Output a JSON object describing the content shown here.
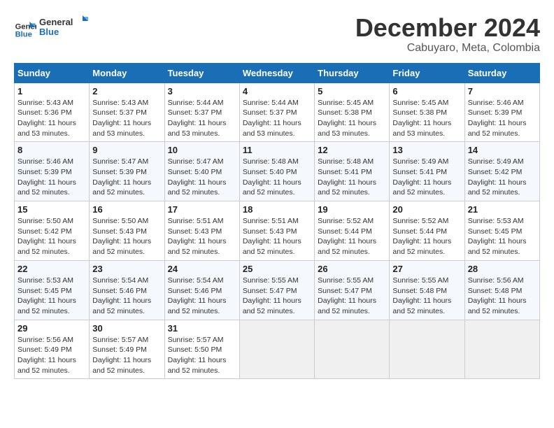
{
  "logo": {
    "line1": "General",
    "line2": "Blue"
  },
  "title": "December 2024",
  "subtitle": "Cabuyaro, Meta, Colombia",
  "days_of_week": [
    "Sunday",
    "Monday",
    "Tuesday",
    "Wednesday",
    "Thursday",
    "Friday",
    "Saturday"
  ],
  "weeks": [
    [
      {
        "day": 1,
        "sunrise": "5:43 AM",
        "sunset": "5:36 PM",
        "daylight": "11 hours and 53 minutes."
      },
      {
        "day": 2,
        "sunrise": "5:43 AM",
        "sunset": "5:37 PM",
        "daylight": "11 hours and 53 minutes."
      },
      {
        "day": 3,
        "sunrise": "5:44 AM",
        "sunset": "5:37 PM",
        "daylight": "11 hours and 53 minutes."
      },
      {
        "day": 4,
        "sunrise": "5:44 AM",
        "sunset": "5:37 PM",
        "daylight": "11 hours and 53 minutes."
      },
      {
        "day": 5,
        "sunrise": "5:45 AM",
        "sunset": "5:38 PM",
        "daylight": "11 hours and 53 minutes."
      },
      {
        "day": 6,
        "sunrise": "5:45 AM",
        "sunset": "5:38 PM",
        "daylight": "11 hours and 53 minutes."
      },
      {
        "day": 7,
        "sunrise": "5:46 AM",
        "sunset": "5:39 PM",
        "daylight": "11 hours and 52 minutes."
      }
    ],
    [
      {
        "day": 8,
        "sunrise": "5:46 AM",
        "sunset": "5:39 PM",
        "daylight": "11 hours and 52 minutes."
      },
      {
        "day": 9,
        "sunrise": "5:47 AM",
        "sunset": "5:39 PM",
        "daylight": "11 hours and 52 minutes."
      },
      {
        "day": 10,
        "sunrise": "5:47 AM",
        "sunset": "5:40 PM",
        "daylight": "11 hours and 52 minutes."
      },
      {
        "day": 11,
        "sunrise": "5:48 AM",
        "sunset": "5:40 PM",
        "daylight": "11 hours and 52 minutes."
      },
      {
        "day": 12,
        "sunrise": "5:48 AM",
        "sunset": "5:41 PM",
        "daylight": "11 hours and 52 minutes."
      },
      {
        "day": 13,
        "sunrise": "5:49 AM",
        "sunset": "5:41 PM",
        "daylight": "11 hours and 52 minutes."
      },
      {
        "day": 14,
        "sunrise": "5:49 AM",
        "sunset": "5:42 PM",
        "daylight": "11 hours and 52 minutes."
      }
    ],
    [
      {
        "day": 15,
        "sunrise": "5:50 AM",
        "sunset": "5:42 PM",
        "daylight": "11 hours and 52 minutes."
      },
      {
        "day": 16,
        "sunrise": "5:50 AM",
        "sunset": "5:43 PM",
        "daylight": "11 hours and 52 minutes."
      },
      {
        "day": 17,
        "sunrise": "5:51 AM",
        "sunset": "5:43 PM",
        "daylight": "11 hours and 52 minutes."
      },
      {
        "day": 18,
        "sunrise": "5:51 AM",
        "sunset": "5:43 PM",
        "daylight": "11 hours and 52 minutes."
      },
      {
        "day": 19,
        "sunrise": "5:52 AM",
        "sunset": "5:44 PM",
        "daylight": "11 hours and 52 minutes."
      },
      {
        "day": 20,
        "sunrise": "5:52 AM",
        "sunset": "5:44 PM",
        "daylight": "11 hours and 52 minutes."
      },
      {
        "day": 21,
        "sunrise": "5:53 AM",
        "sunset": "5:45 PM",
        "daylight": "11 hours and 52 minutes."
      }
    ],
    [
      {
        "day": 22,
        "sunrise": "5:53 AM",
        "sunset": "5:45 PM",
        "daylight": "11 hours and 52 minutes."
      },
      {
        "day": 23,
        "sunrise": "5:54 AM",
        "sunset": "5:46 PM",
        "daylight": "11 hours and 52 minutes."
      },
      {
        "day": 24,
        "sunrise": "5:54 AM",
        "sunset": "5:46 PM",
        "daylight": "11 hours and 52 minutes."
      },
      {
        "day": 25,
        "sunrise": "5:55 AM",
        "sunset": "5:47 PM",
        "daylight": "11 hours and 52 minutes."
      },
      {
        "day": 26,
        "sunrise": "5:55 AM",
        "sunset": "5:47 PM",
        "daylight": "11 hours and 52 minutes."
      },
      {
        "day": 27,
        "sunrise": "5:55 AM",
        "sunset": "5:48 PM",
        "daylight": "11 hours and 52 minutes."
      },
      {
        "day": 28,
        "sunrise": "5:56 AM",
        "sunset": "5:48 PM",
        "daylight": "11 hours and 52 minutes."
      }
    ],
    [
      {
        "day": 29,
        "sunrise": "5:56 AM",
        "sunset": "5:49 PM",
        "daylight": "11 hours and 52 minutes."
      },
      {
        "day": 30,
        "sunrise": "5:57 AM",
        "sunset": "5:49 PM",
        "daylight": "11 hours and 52 minutes."
      },
      {
        "day": 31,
        "sunrise": "5:57 AM",
        "sunset": "5:50 PM",
        "daylight": "11 hours and 52 minutes."
      },
      null,
      null,
      null,
      null
    ]
  ],
  "labels": {
    "sunrise": "Sunrise:",
    "sunset": "Sunset:",
    "daylight": "Daylight:"
  }
}
